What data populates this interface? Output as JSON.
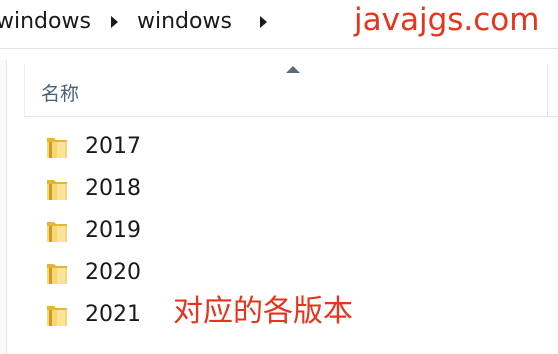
{
  "breadcrumb": {
    "items": [
      "windows",
      "windows"
    ]
  },
  "watermark": {
    "text": "javajgs.com",
    "color": "#e8341c"
  },
  "column_header": {
    "name_label": "名称",
    "sort": "ascending"
  },
  "files": [
    {
      "name": "2017",
      "type": "folder"
    },
    {
      "name": "2018",
      "type": "folder"
    },
    {
      "name": "2019",
      "type": "folder"
    },
    {
      "name": "2020",
      "type": "folder"
    },
    {
      "name": "2021",
      "type": "folder"
    }
  ],
  "annotation": {
    "text": "对应的各版本",
    "color": "#e8341c"
  },
  "icons": {
    "folder": "folder-icon",
    "separator": "chevron-right-icon",
    "sort": "sort-up-icon"
  }
}
